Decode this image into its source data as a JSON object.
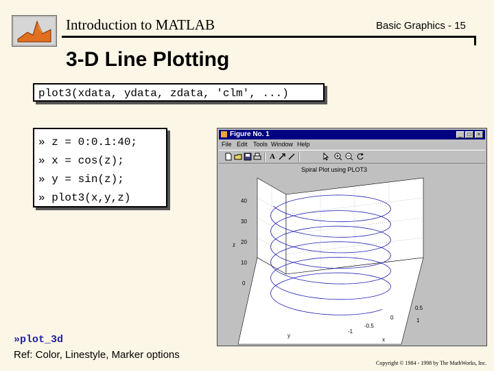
{
  "header": {
    "title": "Introduction to MATLAB",
    "section": "Basic Graphics - 15"
  },
  "slide": {
    "title": "3-D Line Plotting",
    "syntax": "plot3(xdata, ydata, zdata, 'clm', ...)",
    "commands": [
      "» z = 0:0.1:40;",
      "» x = cos(z);",
      "» y = sin(z);",
      "» plot3(x,y,z)"
    ],
    "demo_link": "»plot_3d",
    "reference": "Ref: Color, Linestyle, Marker options",
    "copyright": "Copyright © 1984 - 1998 by The MathWorks, Inc."
  },
  "figure_window": {
    "title": "Figure No. 1",
    "buttons": {
      "minimize": "_",
      "maximize": "□",
      "close": "×"
    },
    "menu": [
      "File",
      "Edit",
      "Tools",
      "Window",
      "Help"
    ],
    "toolbar_icons": [
      "new-icon",
      "open-icon",
      "save-icon",
      "print-icon",
      "text-icon",
      "arrow-icon",
      "line-icon",
      "select-icon",
      "zoom-in-icon",
      "zoom-out-icon",
      "rotate-icon"
    ],
    "plot": {
      "title": "Spiral Plot using PLOT3",
      "z_ticks": [
        "40",
        "30",
        "20",
        "10",
        "0"
      ],
      "x_ticks": [
        "-1",
        "-0.5",
        "0",
        "0.5",
        "1"
      ],
      "y_ticks": [
        "0.5"
      ],
      "xlabel": "x",
      "ylabel": "y",
      "zlabel": "z"
    },
    "colors": {
      "line": "#1c1cb4",
      "titlebar": "#000080",
      "chrome": "#c0c0c0"
    }
  }
}
